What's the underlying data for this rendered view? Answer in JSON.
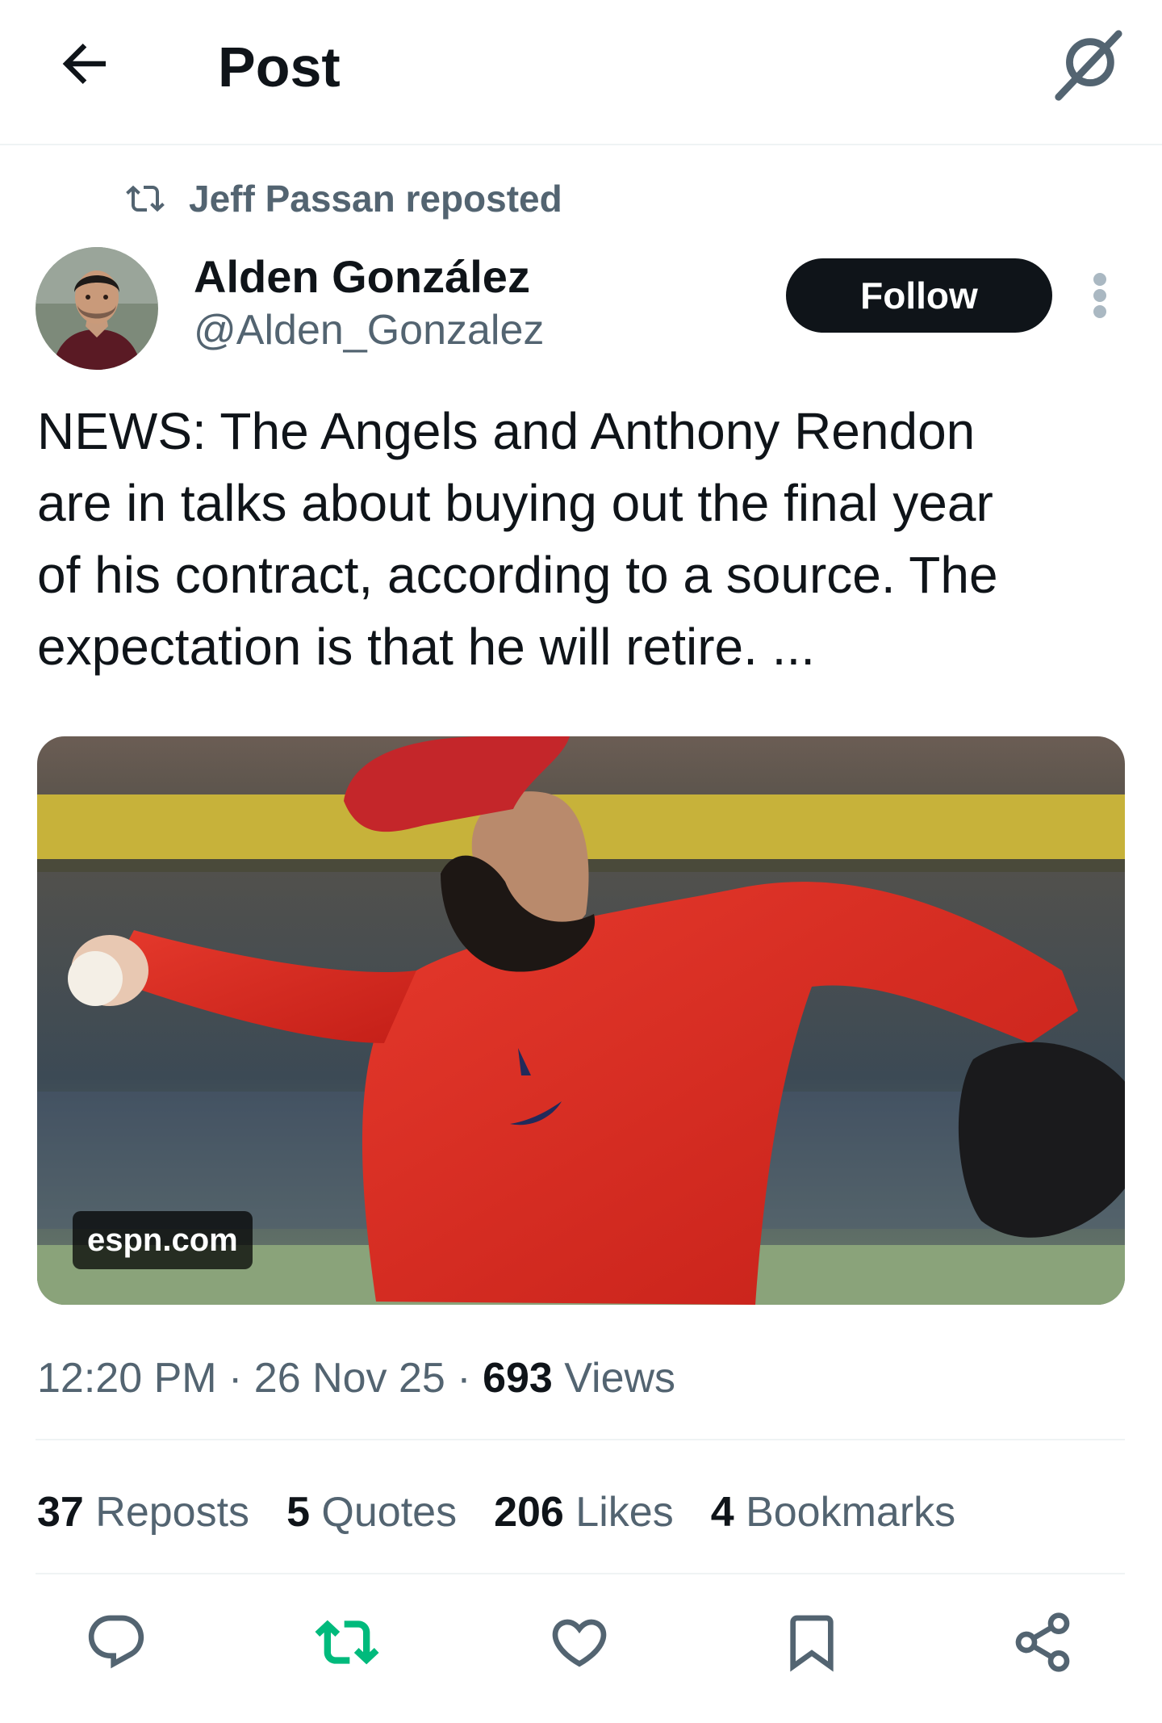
{
  "header": {
    "title": "Post"
  },
  "repost": {
    "text": "Jeff Passan reposted"
  },
  "author": {
    "name": "Alden González",
    "handle": "@Alden_Gonzalez",
    "follow_label": "Follow"
  },
  "post": {
    "text": "NEWS: The Angels and Anthony Rendon\nare in talks about buying out the final year\nof his contract, according to a source. The\nexpectation is that he will retire. ..."
  },
  "media": {
    "source": "espn.com"
  },
  "meta": {
    "time": "12:20 PM",
    "sep": " · ",
    "date": "26 Nov 25",
    "views_count": "693",
    "views_label": " Views"
  },
  "stats": [
    {
      "count": "37",
      "label": " Reposts"
    },
    {
      "count": "5",
      "label": " Quotes"
    },
    {
      "count": "206",
      "label": " Likes"
    },
    {
      "count": "4",
      "label": " Bookmarks"
    }
  ],
  "colors": {
    "text": "#0f1419",
    "secondary": "#536471",
    "repost_green": "#00ba7c",
    "divider": "#eff3f4"
  },
  "icons": {
    "header": [
      "back-arrow-icon",
      "grok-icon"
    ],
    "actions": [
      "reply-icon",
      "repost-icon",
      "like-icon",
      "bookmark-icon",
      "share-icon"
    ]
  }
}
